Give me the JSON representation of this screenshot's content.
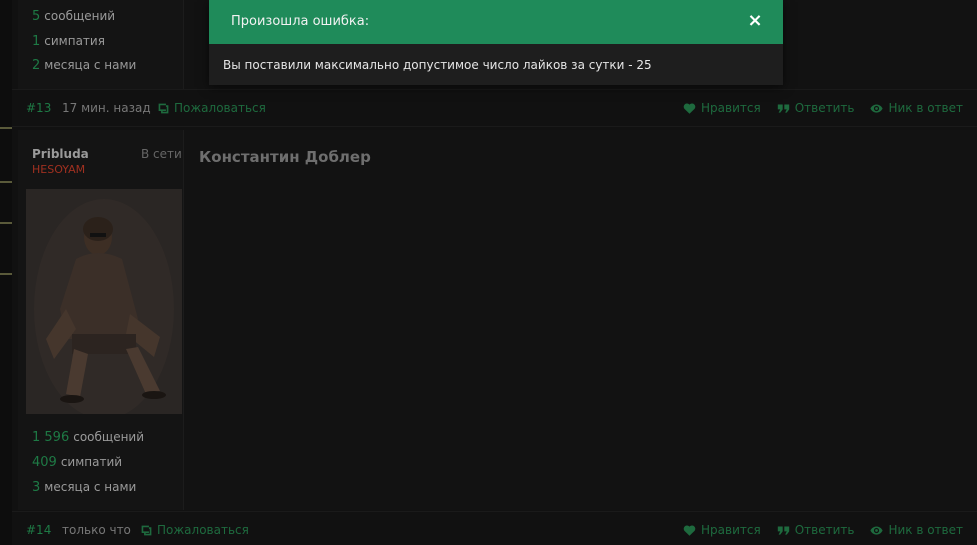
{
  "post_top": {
    "stats": [
      {
        "num": "5",
        "label": "сообщений"
      },
      {
        "num": "1",
        "label": "симпатия"
      },
      {
        "num": "2",
        "label": "месяца с нами"
      }
    ],
    "footer": {
      "post_num": "#13",
      "time": "17 мин. назад",
      "report": "Пожаловаться",
      "like": "Нравится",
      "reply": "Ответить",
      "nick_reply": "Ник в ответ"
    }
  },
  "post_bottom": {
    "author": {
      "name": "Pribluda",
      "status": "В сети",
      "title": "HESOYAM"
    },
    "stats": [
      {
        "num": "1 596",
        "label": "сообщений"
      },
      {
        "num": "409",
        "label": "симпатий"
      },
      {
        "num": "3",
        "label": "месяца с нами"
      }
    ],
    "content_title": "Константин Доблер",
    "footer": {
      "post_num": "#14",
      "time": "только что",
      "report": "Пожаловаться",
      "like": "Нравится",
      "reply": "Ответить",
      "nick_reply": "Ник в ответ"
    }
  },
  "toast": {
    "title": "Произошла ошибка:",
    "close": "×",
    "message": "Вы поставили максимально допустимое число лайков за сутки - 25",
    "accent_color": "#1f8b5a"
  },
  "colors": {
    "background": "#111111",
    "accent_green": "#1e7a45",
    "user_title_red": "#a03020"
  }
}
